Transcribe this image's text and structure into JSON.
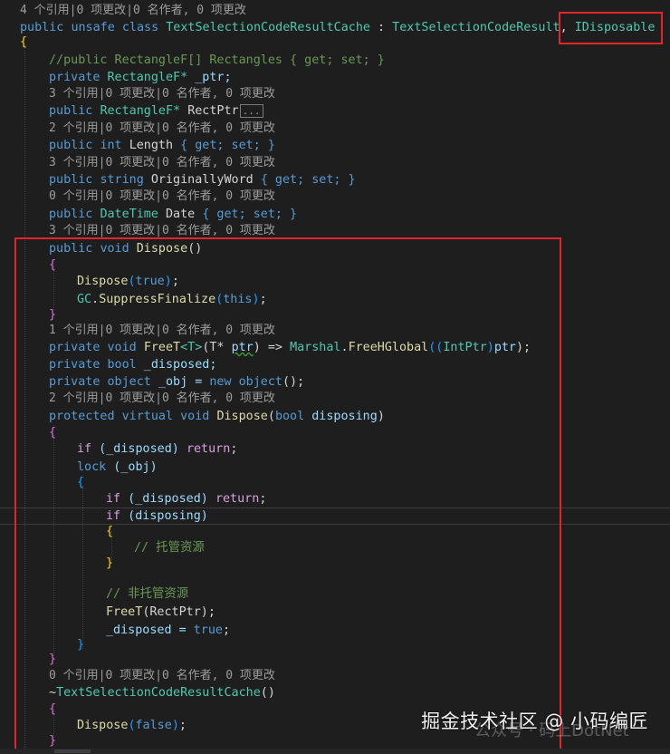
{
  "code": {
    "lens_class": "4 个引用|0 项更改|0 名作者, 0 项更改",
    "class_decl": {
      "kw1": "public",
      "kw2": "unsafe",
      "kw3": "class",
      "name": "TextSelectionCodeResultCache",
      "sep": " : ",
      "base": "TextSelectionCodeResult",
      "comma": ",",
      "iface": "IDisposable"
    },
    "open_brace": "{",
    "comment_rects": "//public RectangleF[] Rectangles { get; set; }",
    "ptr_field": {
      "kw": "private",
      "type": "RectangleF*",
      "name": " _ptr;"
    },
    "lens_3a": "3 个引用|0 项更改|0 名作者, 0 项更改",
    "rectptr": {
      "kw": "public",
      "type": "RectangleF*",
      "name": "RectPtr",
      "ellipsis": "..."
    },
    "lens_2a": "2 个引用|0 项更改|0 名作者, 0 项更改",
    "length_prop": {
      "kw1": "public",
      "kw2": "int",
      "name": "Length",
      "acc": "{ get; set; }"
    },
    "lens_3b": "3 个引用|0 项更改|0 名作者, 0 项更改",
    "orig_prop": {
      "kw1": "public",
      "kw2": "string",
      "name": "OriginallyWord",
      "acc": "{ get; set; }"
    },
    "lens_0a": "0 个引用|0 项更改|0 名作者, 0 项更改",
    "date_prop": {
      "kw1": "public",
      "type": "DateTime",
      "name": "Date",
      "acc": "{ get; set; }"
    },
    "lens_3c": "3 个引用|0 项更改|0 名作者, 0 项更改",
    "dispose_decl": {
      "kw1": "public",
      "kw2": "void",
      "name": "Dispose",
      "parens": "()"
    },
    "brace_open": "{",
    "brace_close": "}",
    "call_dispose_true": {
      "fn": "Dispose",
      "arg": "true",
      "end": ";"
    },
    "call_gc": {
      "type": "GC",
      "dot": ".",
      "fn": "SuppressFinalize",
      "arg": "this",
      "end": ";"
    },
    "lens_1a": "1 个引用|0 项更改|0 名作者, 0 项更改",
    "freet_decl": {
      "kw1": "private",
      "kw2": "void",
      "fn": "FreeT",
      "gen": "<T>",
      "p1": "(T*",
      "param": "ptr",
      "arrow": ") => ",
      "type": "Marshal",
      "dot": ".",
      "fn2": "FreeHGlobal",
      "cast_open": "((",
      "cast_type": "IntPtr",
      "cast_close": ")",
      "arg": "ptr",
      "end": ");"
    },
    "disposed_field": {
      "kw1": "private",
      "kw2": "bool",
      "name": " _disposed;"
    },
    "obj_field": {
      "kw1": "private",
      "kw2": "object",
      "name": " _obj = ",
      "kw3": "new",
      "type": "object",
      "end": "();"
    },
    "lens_2b": "2 个引用|0 项更改|0 名作者, 0 项更改",
    "protected_decl": {
      "kw1": "protected",
      "kw2": "virtual",
      "kw3": "void",
      "fn": "Dispose",
      "p_open": "(",
      "ptype": "bool",
      "param": "disposing",
      "p_close": ")"
    },
    "if_disposed_return": {
      "kw": "if",
      "cond": " (_disposed) ",
      "ret": "return",
      "end": ";"
    },
    "lock_stmt": {
      "kw": "lock",
      "arg": " (_obj)"
    },
    "if_disposing": {
      "kw": "if",
      "cond": " (disposing)"
    },
    "comment_managed": "// 托管资源",
    "comment_unmanaged": "// 非托管资源",
    "call_freet": {
      "fn": "FreeT",
      "arg": "(RectPtr);"
    },
    "set_disposed": {
      "name": "_disposed = ",
      "val": "true",
      "end": ";"
    },
    "lens_0b": "0 个引用|0 项更改|0 名作者, 0 项更改",
    "finalizer": {
      "tilde": "~",
      "type": "TextSelectionCodeResultCache",
      "parens": "()"
    },
    "call_dispose_false": {
      "fn": "Dispose",
      "arg": "false",
      "end": ";"
    }
  },
  "watermark": {
    "text": "掘金技术社区 @ 小码编匠",
    "sub": "公众号 · 码上DotNet"
  },
  "colors": {
    "background": "#1e1e1e",
    "highlight_box": "#e0262b",
    "keyword": "#569cd6",
    "type": "#4ec9b0",
    "method": "#dcdcaa",
    "comment": "#6a9955"
  }
}
